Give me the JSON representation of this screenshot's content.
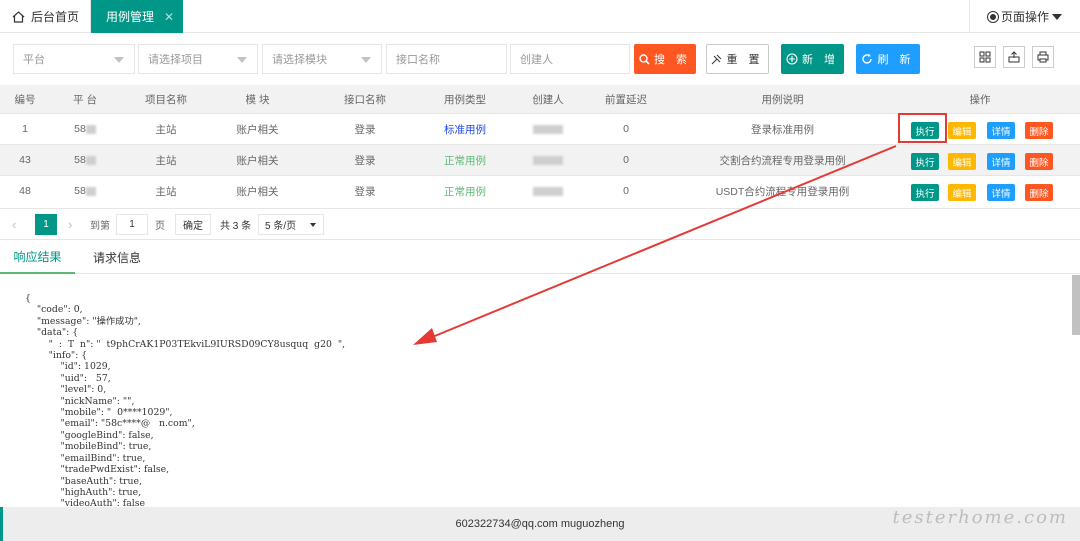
{
  "tabs": {
    "home": "后台首页",
    "active": "用例管理",
    "close": "✕",
    "page_ops": "页面操作"
  },
  "filters": {
    "platform": "平台",
    "project": "请选择项目",
    "module": "请选择模块",
    "api_name": "接口名称",
    "creator": "创建人"
  },
  "buttons": {
    "search": "搜 索",
    "reset": "重 置",
    "add": "新 增",
    "refresh": "刷 新"
  },
  "table": {
    "headers": {
      "no": "编号",
      "platform": "平 台",
      "project": "项目名称",
      "module": "模 块",
      "api": "接口名称",
      "type": "用例类型",
      "creator": "创建人",
      "delay": "前置延迟",
      "desc": "用例说明",
      "ops": "操作"
    },
    "rows": [
      {
        "no": "1",
        "platform": "58",
        "project": "主站",
        "module": "账户相关",
        "api": "登录",
        "type": "标准用例",
        "delay": "0",
        "desc": "登录标准用例"
      },
      {
        "no": "43",
        "platform": "58",
        "project": "主站",
        "module": "账户相关",
        "api": "登录",
        "type": "正常用例",
        "delay": "0",
        "desc": "交割合约流程专用登录用例"
      },
      {
        "no": "48",
        "platform": "58",
        "project": "主站",
        "module": "账户相关",
        "api": "登录",
        "type": "正常用例",
        "delay": "0",
        "desc": "USDT合约流程专用登录用例"
      }
    ],
    "ops": {
      "exec": "执行",
      "edit": "编辑",
      "detail": "详情",
      "del": "删除"
    }
  },
  "pager": {
    "prev": "‹",
    "current": "1",
    "next": "›",
    "goto": "到第",
    "goto_value": "1",
    "page": "页",
    "confirm": "确定",
    "total": "共 3 条",
    "limit": "5 条/页"
  },
  "subtabs": {
    "response": "响应结果",
    "request": "请求信息"
  },
  "json_lines": [
    "{",
    "    \"code\": 0,",
    "    \"message\": \"操作成功\",",
    "    \"data\": {",
    "        \"  :  T  n\": \"  t9phCrAK1P03TEkviL9IURSD09CY8usquq  g20  \",",
    "        \"info\": {",
    "            \"id\": 1029,",
    "            \"uid\":   57,",
    "            \"level\": 0,",
    "            \"nickName\": \"\",",
    "            \"mobile\": \"  0****1029\",",
    "            \"email\": \"58c****@   n.com\",",
    "            \"googleBind\": false,",
    "            \"mobileBind\": true,",
    "            \"emailBind\": true,",
    "            \"tradePwdExist\": false,",
    "            \"baseAuth\": true,",
    "            \"highAuth\": true,",
    "            \"videoAuth\": false"
  ],
  "footer": "602322734@qq.com muguozheng",
  "watermark": "testerhome.com",
  "colors": {
    "primary": "#009688",
    "search": "#ff5722",
    "refresh": "#1e9fff",
    "edit": "#ffb800",
    "annotation": "#e53935"
  }
}
